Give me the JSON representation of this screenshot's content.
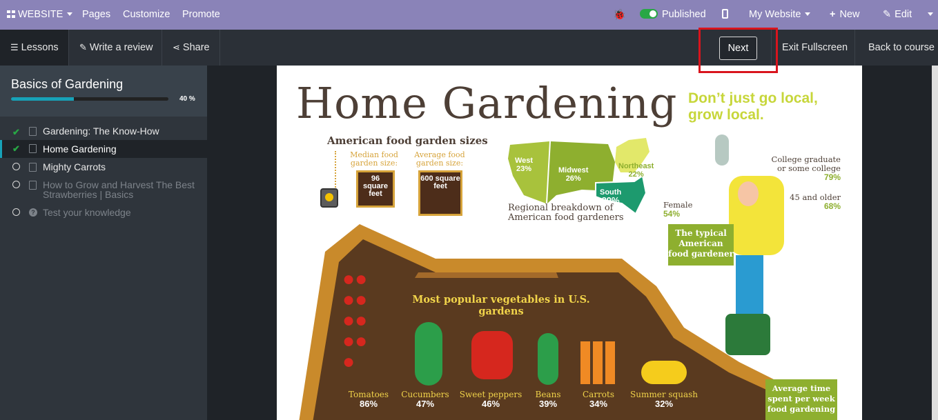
{
  "topbar": {
    "app_menu": "WEBSITE",
    "pages": "Pages",
    "customize": "Customize",
    "promote": "Promote",
    "published": "Published",
    "my_website": "My Website",
    "new": "New",
    "edit": "Edit"
  },
  "subbar": {
    "lessons": "Lessons",
    "write_review": "Write a review",
    "share": "Share",
    "next": "Next",
    "exit_fullscreen": "Exit Fullscreen",
    "back_to_course": "Back to course"
  },
  "sidebar": {
    "course_title": "Basics of Gardening",
    "progress_label": "40 %",
    "progress_value": 0.4,
    "lessons": [
      {
        "label": "Gardening: The Know-How",
        "status": "done"
      },
      {
        "label": "Home Gardening",
        "status": "done",
        "current": true
      },
      {
        "label": "Mighty Carrots",
        "status": "todo"
      },
      {
        "label": "How to Grow and Harvest The Best Strawberries | Basics",
        "status": "todo"
      },
      {
        "label": "Test your knowledge",
        "status": "todo"
      }
    ]
  },
  "infographic": {
    "title": "Home Gardening",
    "tagline": "Don’t just go local, grow local.",
    "garden_sizes_title": "American food garden sizes",
    "median_label": "Median food garden size:",
    "median_value": "96 square feet",
    "average_label": "Average food garden size:",
    "average_value": "600 square feet",
    "regions": [
      {
        "name": "West",
        "pct": "23%"
      },
      {
        "name": "Midwest",
        "pct": "26%"
      },
      {
        "name": "Northeast",
        "pct": "22%"
      },
      {
        "name": "South",
        "pct": "29%"
      }
    ],
    "regional_caption": "Regional breakdown of American food gardeners",
    "vegetables_title": "Most popular vegetables in U.S. gardens",
    "vegetables": [
      {
        "name": "Tomatoes",
        "pct": "86%"
      },
      {
        "name": "Cucumbers",
        "pct": "47%"
      },
      {
        "name": "Sweet peppers",
        "pct": "46%"
      },
      {
        "name": "Beans",
        "pct": "39%"
      },
      {
        "name": "Carrots",
        "pct": "34%"
      },
      {
        "name": "Summer squash",
        "pct": "32%"
      }
    ],
    "college_label": "College graduate or some college",
    "college_pct": "79%",
    "age_label": "45 and older",
    "age_pct": "68%",
    "female_label": "Female",
    "female_pct": "54%",
    "typical_label": "The typical American food gardener",
    "avg_time_label": "Average time spent per week food gardening"
  },
  "colors": {
    "topbar": "#8a83b8",
    "accent": "#17a2b8",
    "done_check": "#28a745",
    "highlight": "#d9141d"
  }
}
